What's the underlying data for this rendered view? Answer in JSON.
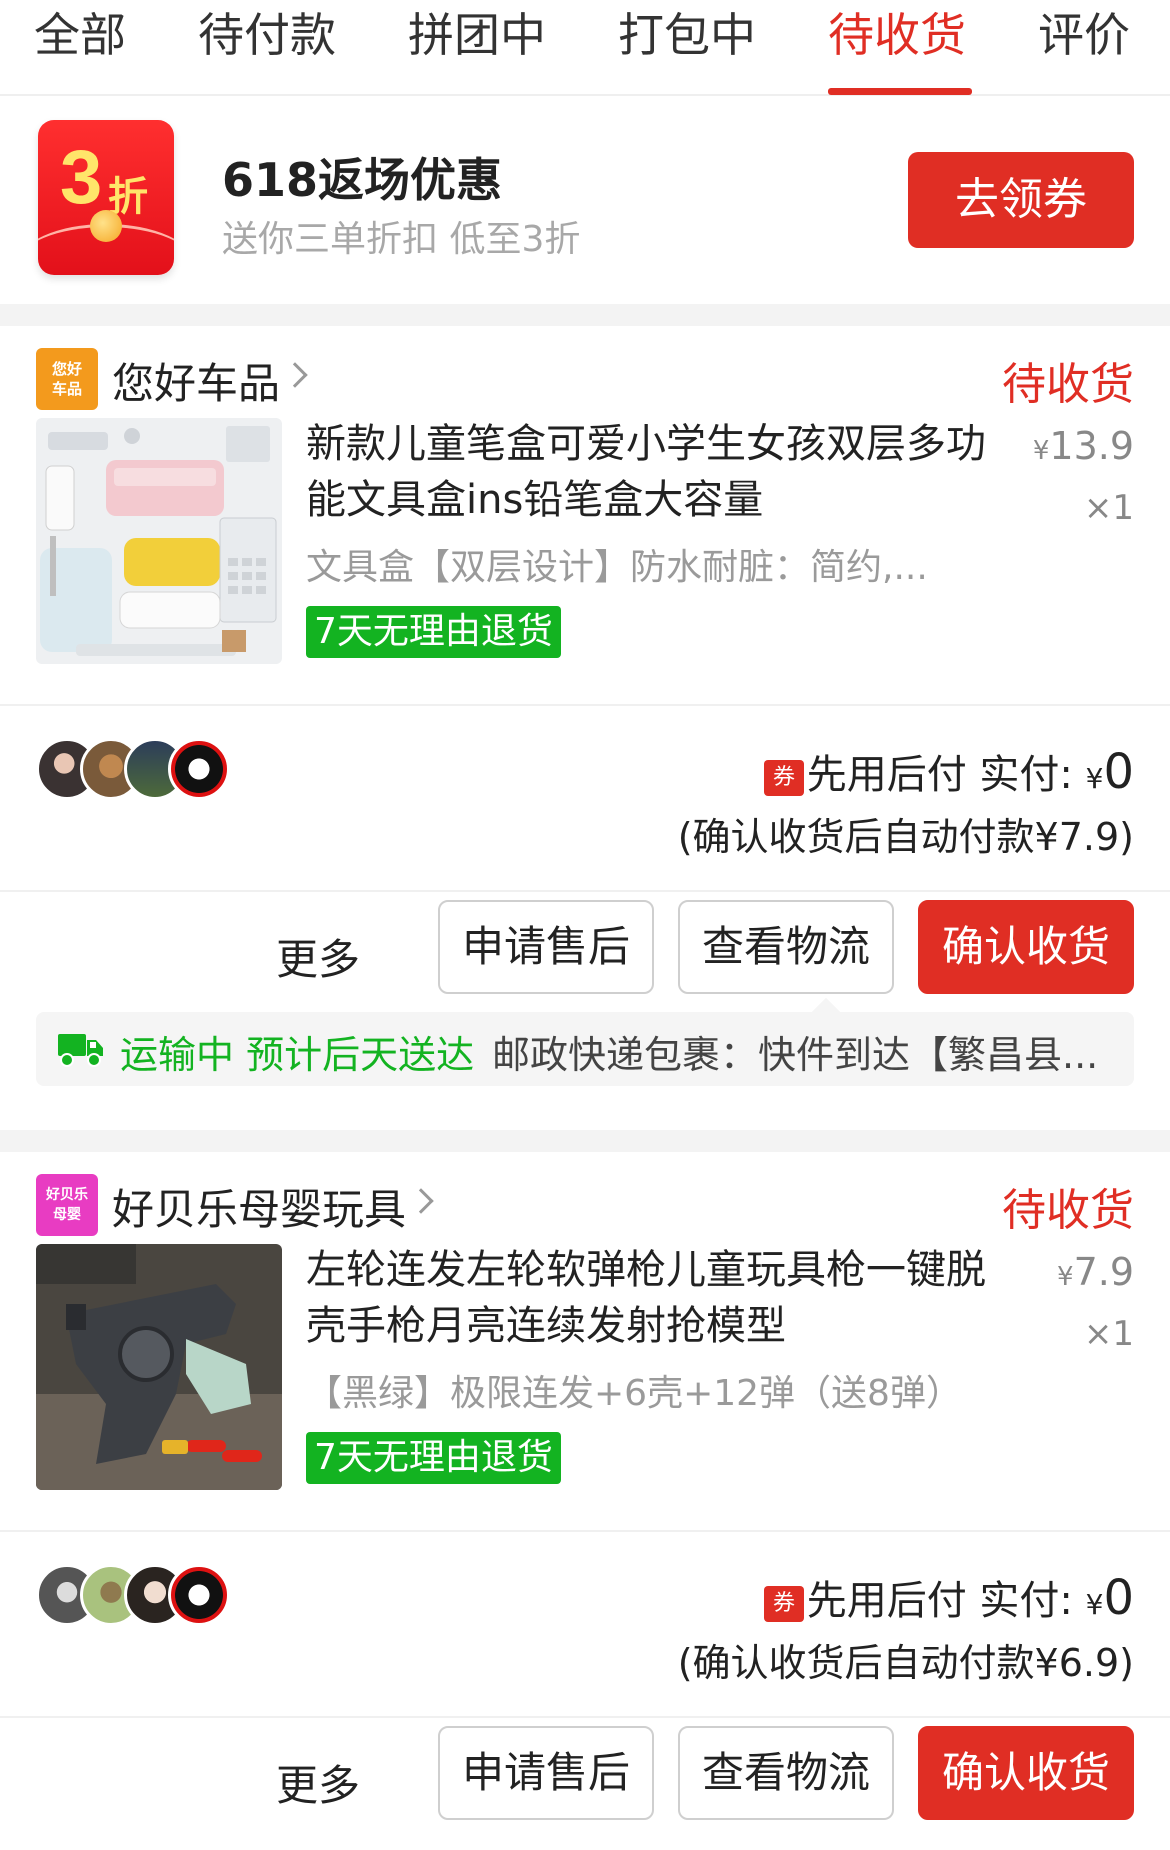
{
  "tabs": [
    {
      "label": "全部",
      "active": false
    },
    {
      "label": "待付款",
      "active": false
    },
    {
      "label": "拼团中",
      "active": false
    },
    {
      "label": "打包中",
      "active": false
    },
    {
      "label": "待收货",
      "active": true
    },
    {
      "label": "评价",
      "active": false
    }
  ],
  "promo": {
    "logo_number": "3",
    "logo_suffix": "折",
    "title": "618返场优惠",
    "subtitle": "送你三单折扣 低至3折",
    "button": "去领券"
  },
  "orders": [
    {
      "shop_badge": [
        "您好",
        "车品"
      ],
      "shop_badge_color": "#f39a1d",
      "shop_name": "您好车品",
      "status": "待收货",
      "title": "新款儿童笔盒可爱小学生女孩双层多功能文具盒ins铅笔盒大容量",
      "price_symbol": "¥",
      "price": "13.9",
      "qty": "×1",
      "spec": "文具盒【双层设计】防水耐脏：简约,...",
      "return_badge": "7天无理由退货",
      "coupon": "券",
      "pay_label": "先用后付 实付:",
      "pay_symbol": "¥",
      "pay_amount": "0",
      "autopay": "(确认收货后自动付款¥7.9)",
      "more": "更多",
      "buttons": [
        "申请售后",
        "查看物流",
        "确认收货"
      ],
      "logistics_status": "运输中 预计后天送达",
      "logistics_detail": "邮政快递包裹：快件到达【繁昌县..."
    },
    {
      "shop_badge": [
        "好贝乐",
        "母婴"
      ],
      "shop_badge_color": "#e83cc2",
      "shop_name": "好贝乐母婴玩具",
      "status": "待收货",
      "title": "左轮连发左轮软弹枪儿童玩具枪一键脱壳手枪月亮连续发射抢模型",
      "price_symbol": "¥",
      "price": "7.9",
      "qty": "×1",
      "spec": "【黑绿】极限连发+6壳+12弹（送8弹）",
      "return_badge": "7天无理由退货",
      "coupon": "券",
      "pay_label": "先用后付 实付:",
      "pay_symbol": "¥",
      "pay_amount": "0",
      "autopay": "(确认收货后自动付款¥6.9)",
      "more": "更多",
      "buttons": [
        "申请售后",
        "查看物流",
        "确认收货"
      ]
    }
  ],
  "colors": {
    "accent": "#e02e24",
    "green": "#13b321"
  }
}
